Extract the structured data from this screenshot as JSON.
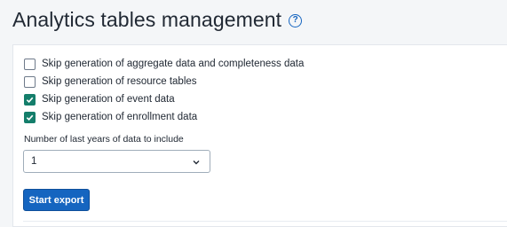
{
  "header": {
    "title": "Analytics tables management",
    "help_icon": "help-circle-icon",
    "help_glyph": "?"
  },
  "options": [
    {
      "label": "Skip generation of aggregate data and completeness data",
      "checked": false
    },
    {
      "label": "Skip generation of resource tables",
      "checked": false
    },
    {
      "label": "Skip generation of event data",
      "checked": true
    },
    {
      "label": "Skip generation of enrollment data",
      "checked": true
    }
  ],
  "years_field": {
    "label": "Number of last years of data to include",
    "value": "1"
  },
  "actions": {
    "start_export_label": "Start export"
  },
  "colors": {
    "accent": "#1565c0",
    "checked": "#147e6b",
    "background": "#f4f6f8"
  }
}
